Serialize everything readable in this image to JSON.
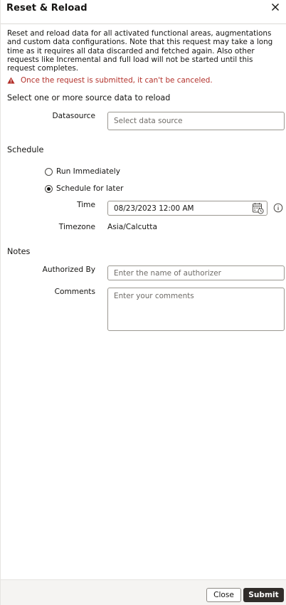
{
  "dialog": {
    "title": "Reset & Reload",
    "description": "Reset and reload data for all activated functional areas, augmentations and custom data configurations. Note that this request may take a long time as it requires all data discarded and fetched again. Also other requests like Incremental and full load will not be started until this request completes.",
    "warning": "Once the request is submitted, it can't be canceled.",
    "source_prompt": "Select one or more source data to reload"
  },
  "datasource": {
    "label": "Datasource",
    "placeholder": "Select data source"
  },
  "schedule": {
    "heading": "Schedule",
    "options": [
      {
        "label": "Run Immediately",
        "checked": false
      },
      {
        "label": "Schedule for later",
        "checked": true
      }
    ],
    "time_label": "Time",
    "time_value": "08/23/2023 12:00 AM",
    "timezone_label": "Timezone",
    "timezone_value": "Asia/Calcutta"
  },
  "notes": {
    "heading": "Notes",
    "authorized_label": "Authorized By",
    "authorized_placeholder": "Enter the name of authorizer",
    "comments_label": "Comments",
    "comments_placeholder": "Enter your comments"
  },
  "footer": {
    "close_label": "Close",
    "submit_label": "Submit"
  },
  "colors": {
    "warning": "#b3312b",
    "primary_button": "#312d2a",
    "footer_bg": "#f5f4f2"
  }
}
